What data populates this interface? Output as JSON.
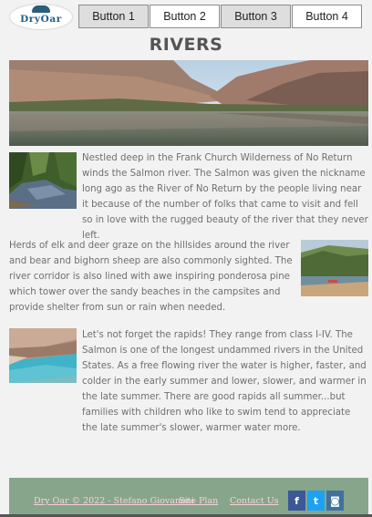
{
  "header": {
    "logo_text": "DryOar",
    "nav": [
      "Button 1",
      "Button 2",
      "Button 3",
      "Button 4"
    ]
  },
  "page_title": "RIVERS",
  "paragraphs": [
    "Nestled deep in the Frank Church Wilderness of No Return winds the Salmon river. The Salmon was given the nickname long ago as the River of No Return by the people living near it because of the number of folks that came to visit and fell so in love with the rugged beauty of the river that they never left.",
    "Herds of elk and deer graze on the hillsides around the river and bear and bighorn sheep are also commonly sighted. The river corridor is also lined with awe inspiring ponderosa pine which tower over the sandy beaches in the campsites and provide shelter from sun or rain when needed.",
    "Let's not forget the rapids! They range from class I-IV. The Salmon is one of the longest undammed rivers in the United States. As a free flowing river the water is higher, faster, and colder in the early summer and lower, slower, and warmer in the late summer. There are good rapids all summer...but families with children who like to swim tend to appreciate the late summer's slower, warmer water more."
  ],
  "footer": {
    "copyright": "Dry Oar © 2022 - Stefano Giovanoni",
    "site_plan": "Site Plan",
    "contact": "Contact Us",
    "social": {
      "facebook": "f",
      "twitter": "t",
      "instagram": "◙"
    }
  }
}
